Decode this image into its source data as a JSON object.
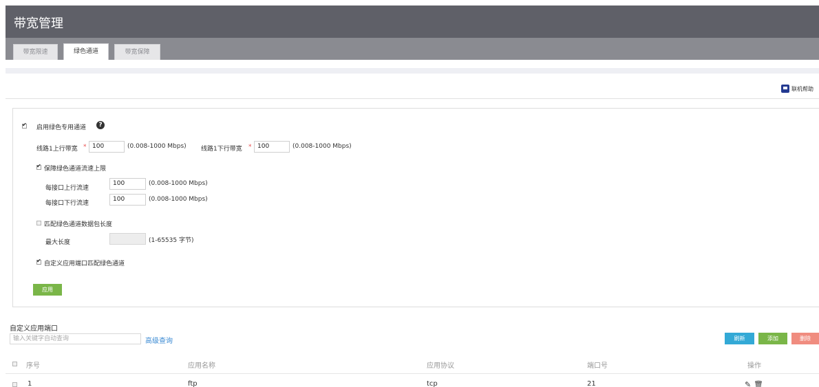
{
  "window": {
    "title": "带宽管理"
  },
  "tabs": [
    {
      "label": "带宽限速",
      "active": false
    },
    {
      "label": "绿色通道",
      "active": true
    },
    {
      "label": "带宽保障",
      "active": false
    }
  ],
  "help": {
    "label": "联机帮助",
    "icon": "book-icon"
  },
  "form": {
    "enable_label": "启用绿色专用通道",
    "enable_checked": true,
    "help_icon": "question-icon",
    "uplink_label": "线路1上行带宽",
    "uplink_value": "100",
    "uplink_range": "(0.008-1000 Mbps)",
    "downlink_label": "线路1下行带宽",
    "downlink_value": "100",
    "downlink_range": "(0.008-1000 Mbps)",
    "required_mark": "*",
    "guarantee_label": "保障绿色通道流速上限",
    "guarantee_checked": true,
    "per_up_label": "每接口上行流速",
    "per_up_value": "100",
    "per_up_range": "(0.008-1000 Mbps)",
    "per_down_label": "每接口下行流速",
    "per_down_value": "100",
    "per_down_range": "(0.008-1000 Mbps)",
    "match_len_label": "匹配绿色通道数据包长度",
    "match_len_checked": false,
    "max_len_label": "最大长度",
    "max_len_value": "",
    "max_len_range": "(1-65535 字节)",
    "custom_port_label": "自定义应用端口匹配绿色通道",
    "custom_port_checked": true,
    "apply_label": "应用"
  },
  "ports": {
    "section_title": "自定义应用端口",
    "search_placeholder": "输入关键字自动查询",
    "advanced_label": "高级查询",
    "refresh_label": "刷新",
    "add_label": "添加",
    "delete_label": "删除",
    "columns": [
      "序号",
      "应用名称",
      "应用协议",
      "端口号",
      "操作"
    ],
    "rows": [
      {
        "index": "1",
        "name": "ftp",
        "protocol": "tcp",
        "port": "21",
        "actions": [
          "edit-icon",
          "delete-icon"
        ]
      }
    ]
  },
  "colors": {
    "titlebar": "#5f6068",
    "tabbar": "#8a8b91",
    "apply_green": "#7ab648",
    "refresh_blue": "#33a9d6",
    "delete_red": "#f08c7f",
    "link_blue": "#3a8ad3"
  }
}
